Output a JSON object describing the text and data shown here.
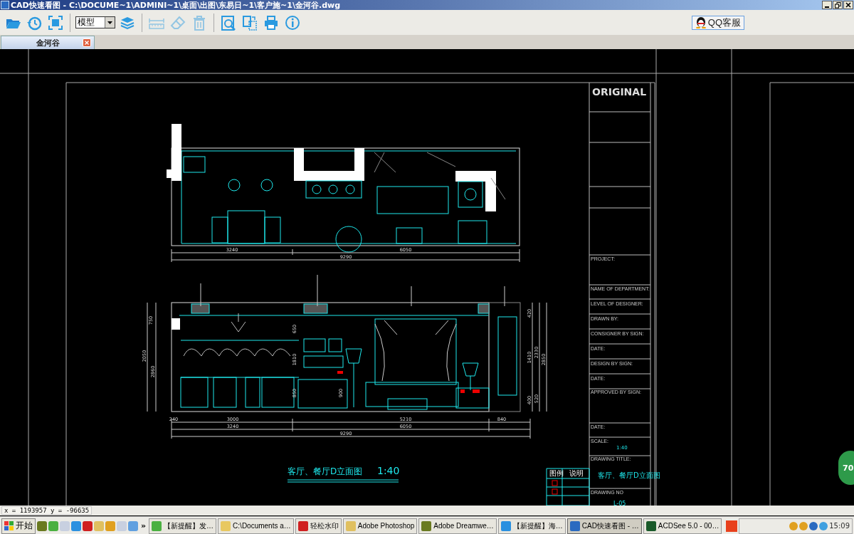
{
  "window": {
    "title": "CAD快速看图 - C:\\DOCUME~1\\ADMINI~1\\桌面\\出图\\东易日~1\\客户施~1\\金河谷.dwg"
  },
  "toolbar": [
    {
      "kind": "button",
      "disabled": false
    },
    {
      "kind": "button",
      "disabled": false
    },
    {
      "kind": "button",
      "disabled": false
    },
    {
      "kind": "separator"
    },
    {
      "kind": "dropdown",
      "value": "模型"
    },
    {
      "kind": "button",
      "disabled": false
    },
    {
      "kind": "separator"
    },
    {
      "kind": "button",
      "disabled": true
    },
    {
      "kind": "button",
      "disabled": true
    },
    {
      "kind": "button",
      "disabled": true
    },
    {
      "kind": "separator"
    },
    {
      "kind": "button",
      "disabled": false
    },
    {
      "kind": "button",
      "disabled": false
    },
    {
      "kind": "button",
      "disabled": false
    },
    {
      "kind": "button",
      "disabled": false
    }
  ],
  "support_button": "QQ客服",
  "tabs": [
    {
      "label": "金河谷",
      "selected": true
    }
  ],
  "drawing": {
    "plan_dimensions": [
      "3240",
      "6050",
      "9290"
    ],
    "elevation_dimensions": [
      "240",
      "3000",
      "5210",
      "840",
      "3240",
      "6050",
      "9290"
    ],
    "vertical_dimensions": [
      "420",
      "1410",
      "2330",
      "2850",
      "400",
      "520",
      "750",
      "2050",
      "2860",
      "650",
      "1810",
      "850",
      "900"
    ],
    "title": "客厅、餐厅D立面图",
    "scale": "1:40"
  },
  "title_block": {
    "logo": "ORIGINAL",
    "fields": [
      {
        "label": "PROJECT:"
      },
      {
        "label": "NAME OF DEPARTMENT:"
      },
      {
        "label": "LEVEL OF DESIGNER:"
      },
      {
        "label": "DRAWN BY:"
      },
      {
        "label": "CONSIGNER BY SIGN:"
      },
      {
        "label": "DATE:"
      },
      {
        "label": "DESIGN BY SIGN:"
      },
      {
        "label": "DATE:"
      },
      {
        "label": "APPROVED BY SIGN:"
      },
      {
        "label": "DATE:"
      },
      {
        "label": "SCALE:"
      },
      {
        "label": "DRAWING TITLE:"
      },
      {
        "label": "DRAWING NO"
      }
    ],
    "scale": "1:40",
    "drawing_title": "客厅、餐厅D立面图",
    "drawing_no": "L-05"
  },
  "legend": {
    "headers": [
      "图例",
      "说明"
    ]
  },
  "side_badge": "70",
  "status_bar": {
    "coordinates": "x = 1193957 y = -96635"
  },
  "taskbar": {
    "start": "开始",
    "more": "»",
    "tasks": [
      {
        "label": "【新提醒】发…",
        "selected": false
      },
      {
        "label": "C:\\Documents a…",
        "selected": false
      },
      {
        "label": "轻松水印",
        "selected": false
      },
      {
        "label": "Adobe Photoshop",
        "selected": false
      },
      {
        "label": "Adobe Dreamwe…",
        "selected": false
      },
      {
        "label": "【新提醒】海…",
        "selected": false
      },
      {
        "label": "CAD快速看图 - …",
        "selected": true
      },
      {
        "label": "ACDSee 5.0 - 00…",
        "selected": false
      }
    ],
    "clock": "15:09"
  }
}
